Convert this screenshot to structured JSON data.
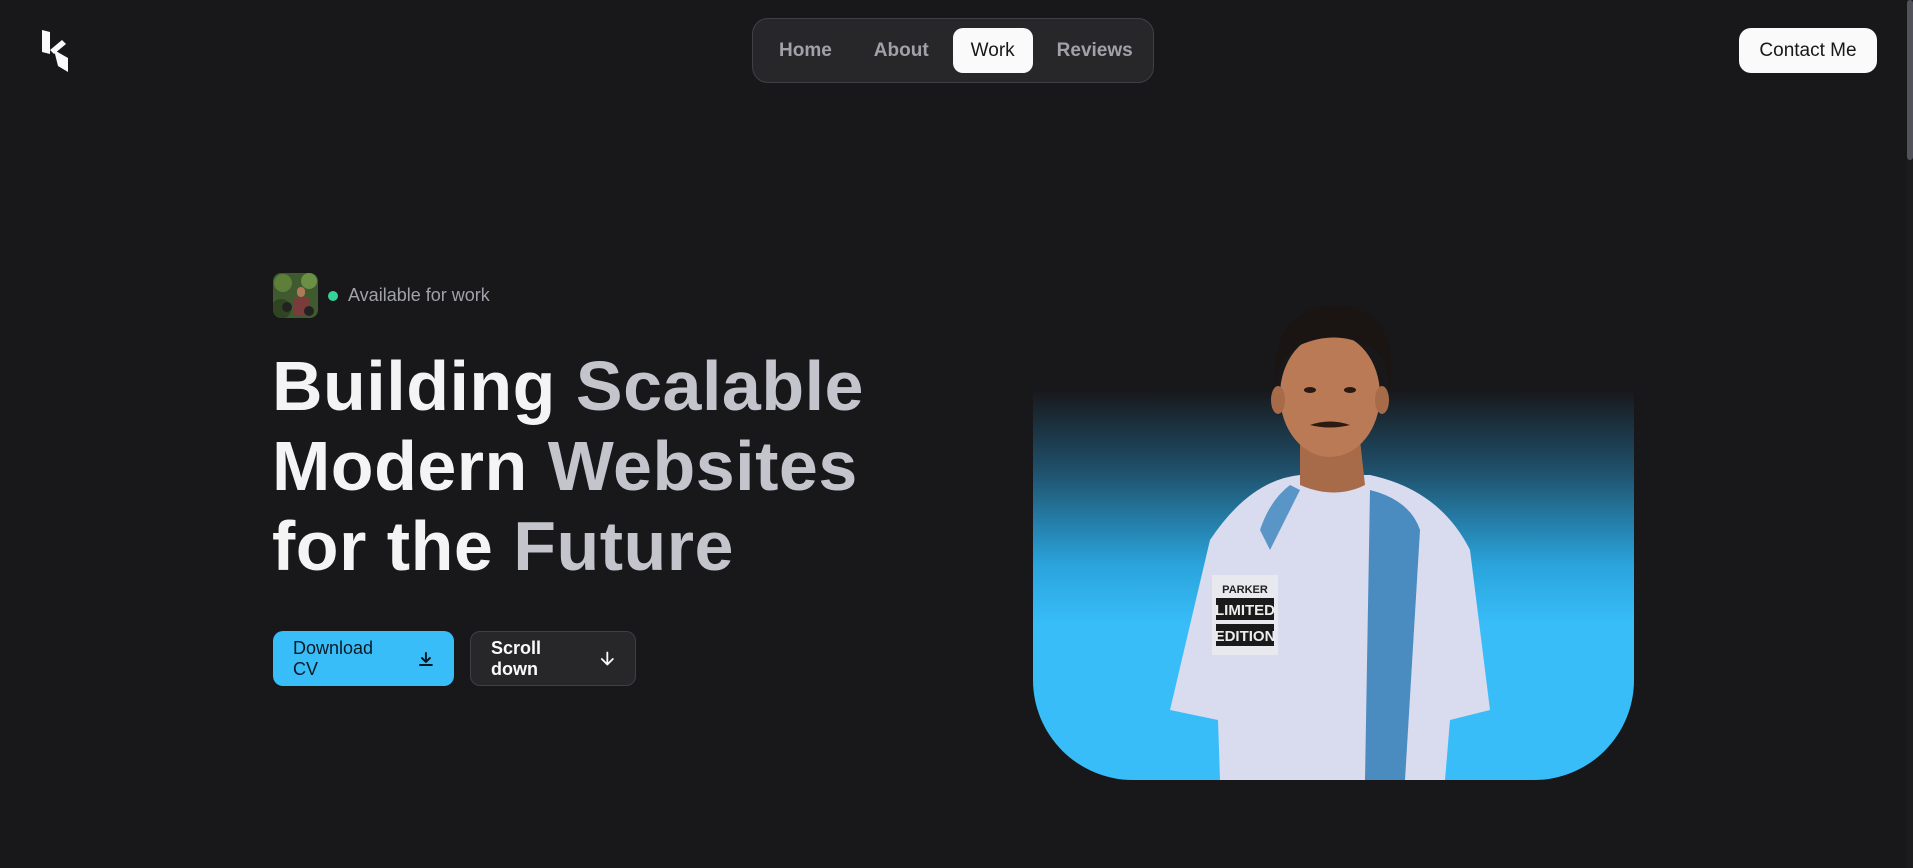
{
  "header": {
    "logo_icon": "k-logo-icon",
    "nav": [
      {
        "label": "Home",
        "active": false
      },
      {
        "label": "About",
        "active": false
      },
      {
        "label": "Work",
        "active": true
      },
      {
        "label": "Reviews",
        "active": false
      }
    ],
    "contact_label": "Contact Me"
  },
  "hero": {
    "availability": "Available for work",
    "headline": {
      "line1_a": "Building",
      "line1_b": "Scalable",
      "line2_a": "Modern",
      "line2_b": "Websites",
      "line3_a": "for the",
      "line3_b": "Future"
    },
    "buttons": {
      "download_label": "Download CV",
      "download_icon": "download-icon",
      "scroll_label": "Scroll down",
      "scroll_icon": "arrow-down-icon"
    },
    "portrait_shirt_text": [
      "PARKER",
      "LIMITED",
      "EDITION"
    ]
  },
  "colors": {
    "background": "#18181b",
    "accent": "#38bdf8",
    "status_dot": "#34d399"
  }
}
